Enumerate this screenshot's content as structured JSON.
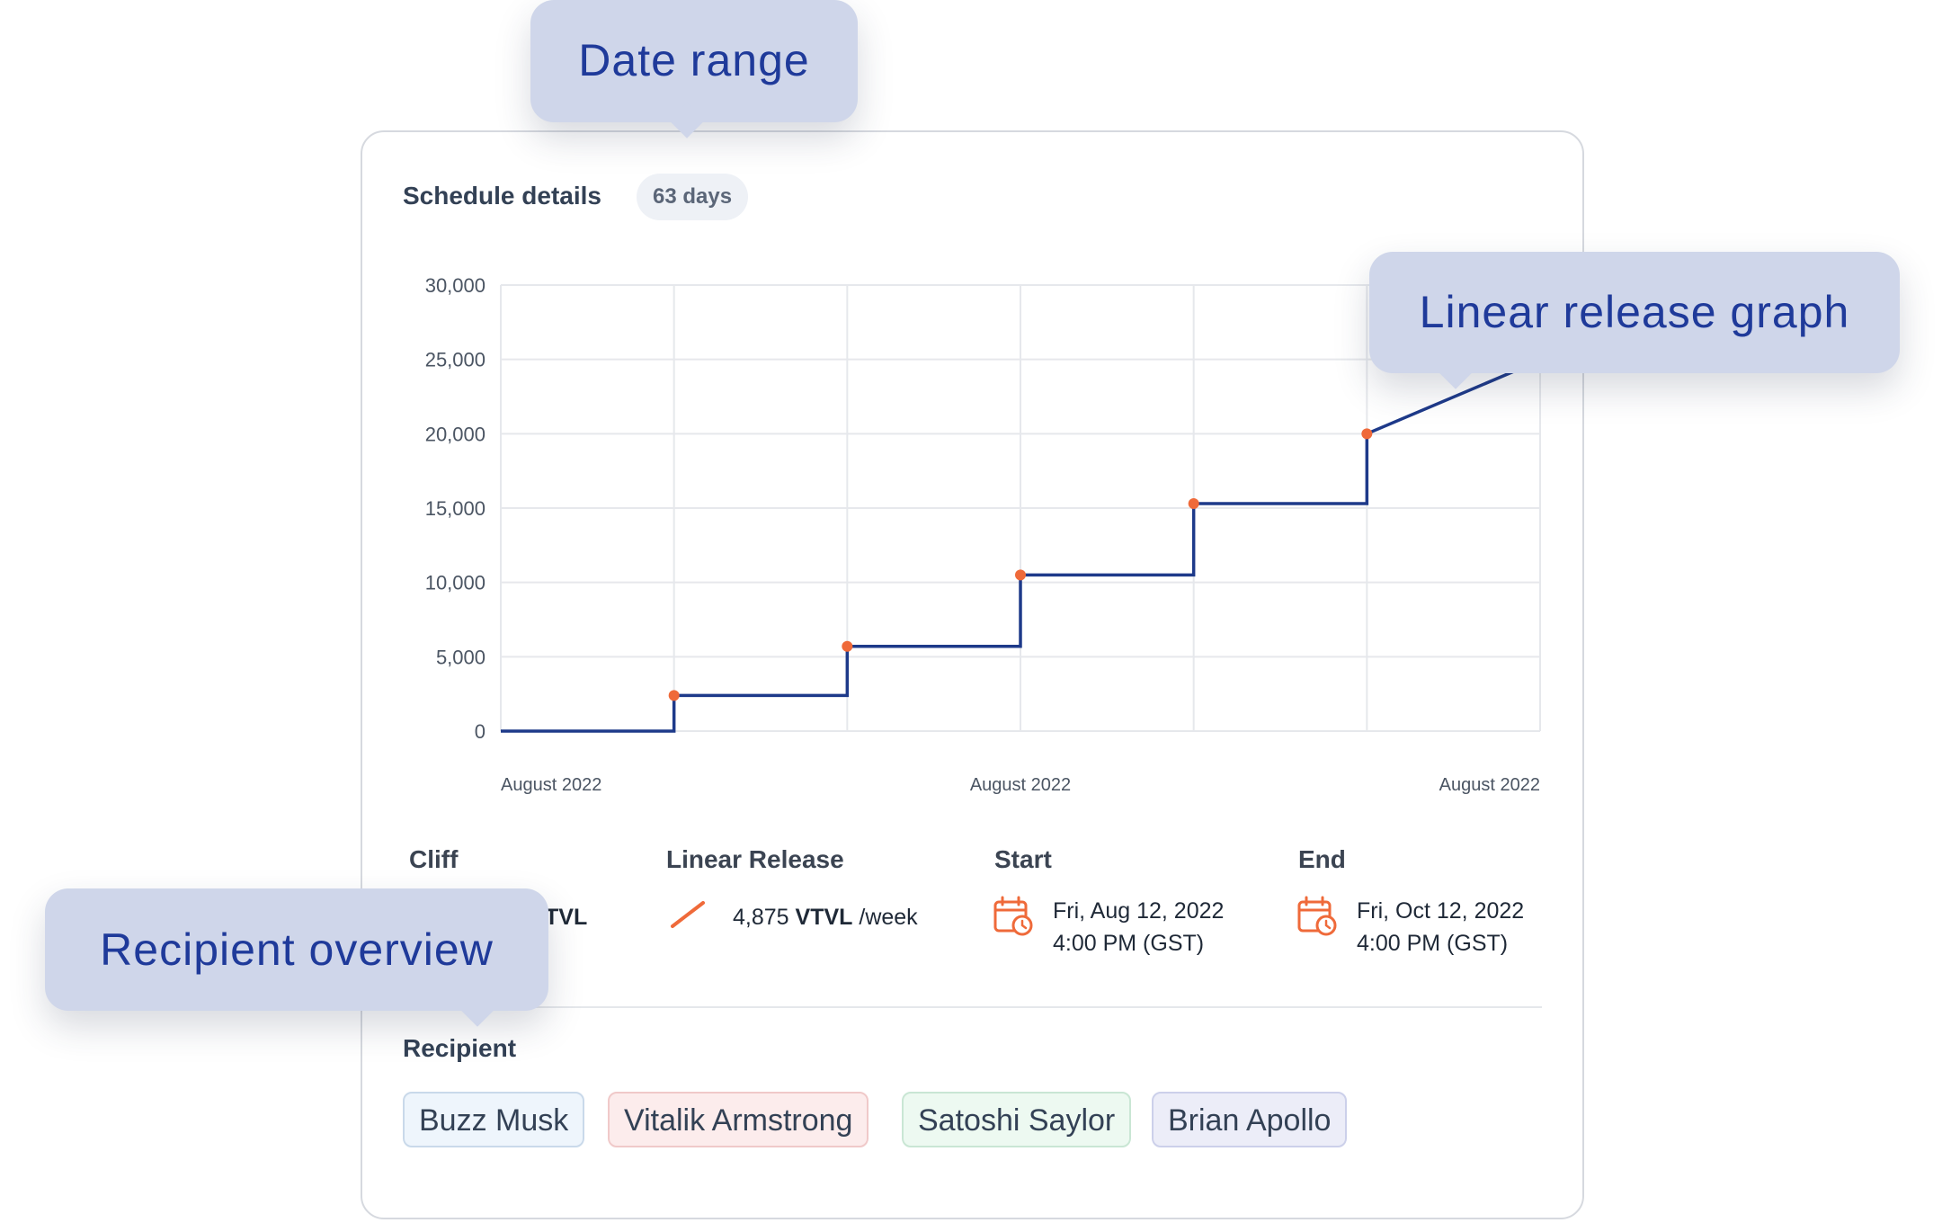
{
  "callouts": {
    "date_range": "Date range",
    "linear_release_graph": "Linear release graph",
    "recipient_overview": "Recipient overview"
  },
  "card": {
    "title": "Schedule details",
    "duration_badge": "63 days"
  },
  "chart_data": {
    "type": "line",
    "title": "",
    "xlabel": "",
    "ylabel": "",
    "ylim": [
      0,
      30000
    ],
    "y_ticks": [
      "30,000",
      "25,000",
      "20,000",
      "15,000",
      "10,000",
      "5,000",
      "0"
    ],
    "x_tick_labels": [
      "August 2022",
      "August 2022",
      "August 2022"
    ],
    "grid": true,
    "series": [
      {
        "line_color": "#1e3a8a",
        "marker_color": "#ef6a3a",
        "x": [
          0,
          1,
          1,
          2,
          2,
          3,
          3,
          4,
          4,
          5,
          5,
          5.85
        ],
        "values": [
          0,
          0,
          2400,
          2400,
          5700,
          5700,
          10500,
          10500,
          15300,
          15300,
          20000,
          24200
        ]
      }
    ],
    "markers": [
      {
        "x": 1,
        "y": 2400
      },
      {
        "x": 2,
        "y": 5700
      },
      {
        "x": 3,
        "y": 10500
      },
      {
        "x": 4,
        "y": 15300
      },
      {
        "x": 5,
        "y": 20000
      }
    ],
    "x_domain": [
      0,
      6
    ]
  },
  "details": {
    "cliff": {
      "label": "Cliff",
      "value_partial": "TVL"
    },
    "linear_release": {
      "label": "Linear Release",
      "amount": "4,875",
      "token": "VTVL",
      "unit": "/week"
    },
    "start": {
      "label": "Start",
      "date": "Fri, Aug 12, 2022",
      "time": "4:00 PM (GST)"
    },
    "end": {
      "label": "End",
      "date": "Fri, Oct 12, 2022",
      "time": "4:00 PM (GST)"
    }
  },
  "recipients": {
    "label": "Recipient",
    "names": [
      "Buzz Musk",
      "Vitalik Armstrong",
      "Satoshi Saylor",
      "Brian Apollo"
    ]
  },
  "colors": {
    "accent": "#ef6a3a",
    "line": "#1e3a8a",
    "callout_bg": "#cfd6ea",
    "callout_text": "#1f3a9a"
  }
}
